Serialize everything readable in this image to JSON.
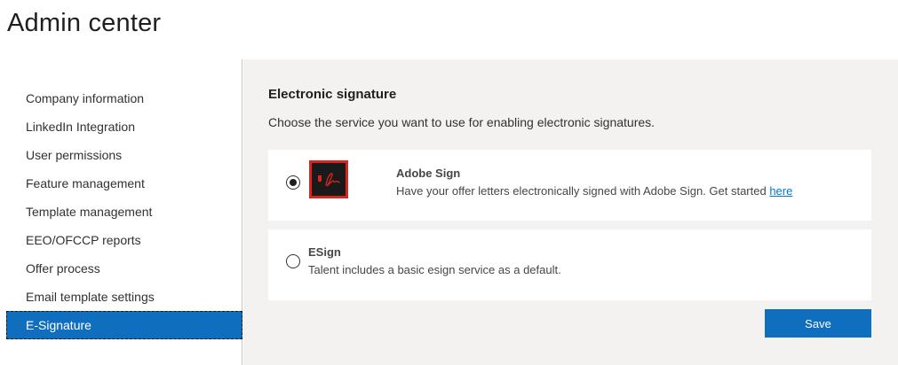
{
  "page": {
    "title": "Admin center"
  },
  "sidebar": {
    "items": [
      {
        "label": "Company information",
        "active": false
      },
      {
        "label": "LinkedIn Integration",
        "active": false
      },
      {
        "label": "User permissions",
        "active": false
      },
      {
        "label": "Feature management",
        "active": false
      },
      {
        "label": "Template management",
        "active": false
      },
      {
        "label": "EEO/OFCCP reports",
        "active": false
      },
      {
        "label": "Offer process",
        "active": false
      },
      {
        "label": "Email template settings",
        "active": false
      },
      {
        "label": "E-Signature",
        "active": true
      }
    ]
  },
  "main": {
    "heading": "Electronic signature",
    "description": "Choose the service you want to use for enabling electronic signatures.",
    "options": {
      "adobe": {
        "title": "Adobe Sign",
        "text": "Have your offer letters electronically signed with Adobe Sign. Get started ",
        "link": "here",
        "selected": true,
        "icon": "adobe-sign-logo"
      },
      "esign": {
        "title": "ESign",
        "text": "Talent includes a basic esign service as a default.",
        "selected": false
      }
    },
    "save_label": "Save"
  },
  "colors": {
    "accent": "#106ebe",
    "link": "#0078d4",
    "content_background": "#f3f2f1",
    "adobe_red": "#d7261d"
  }
}
